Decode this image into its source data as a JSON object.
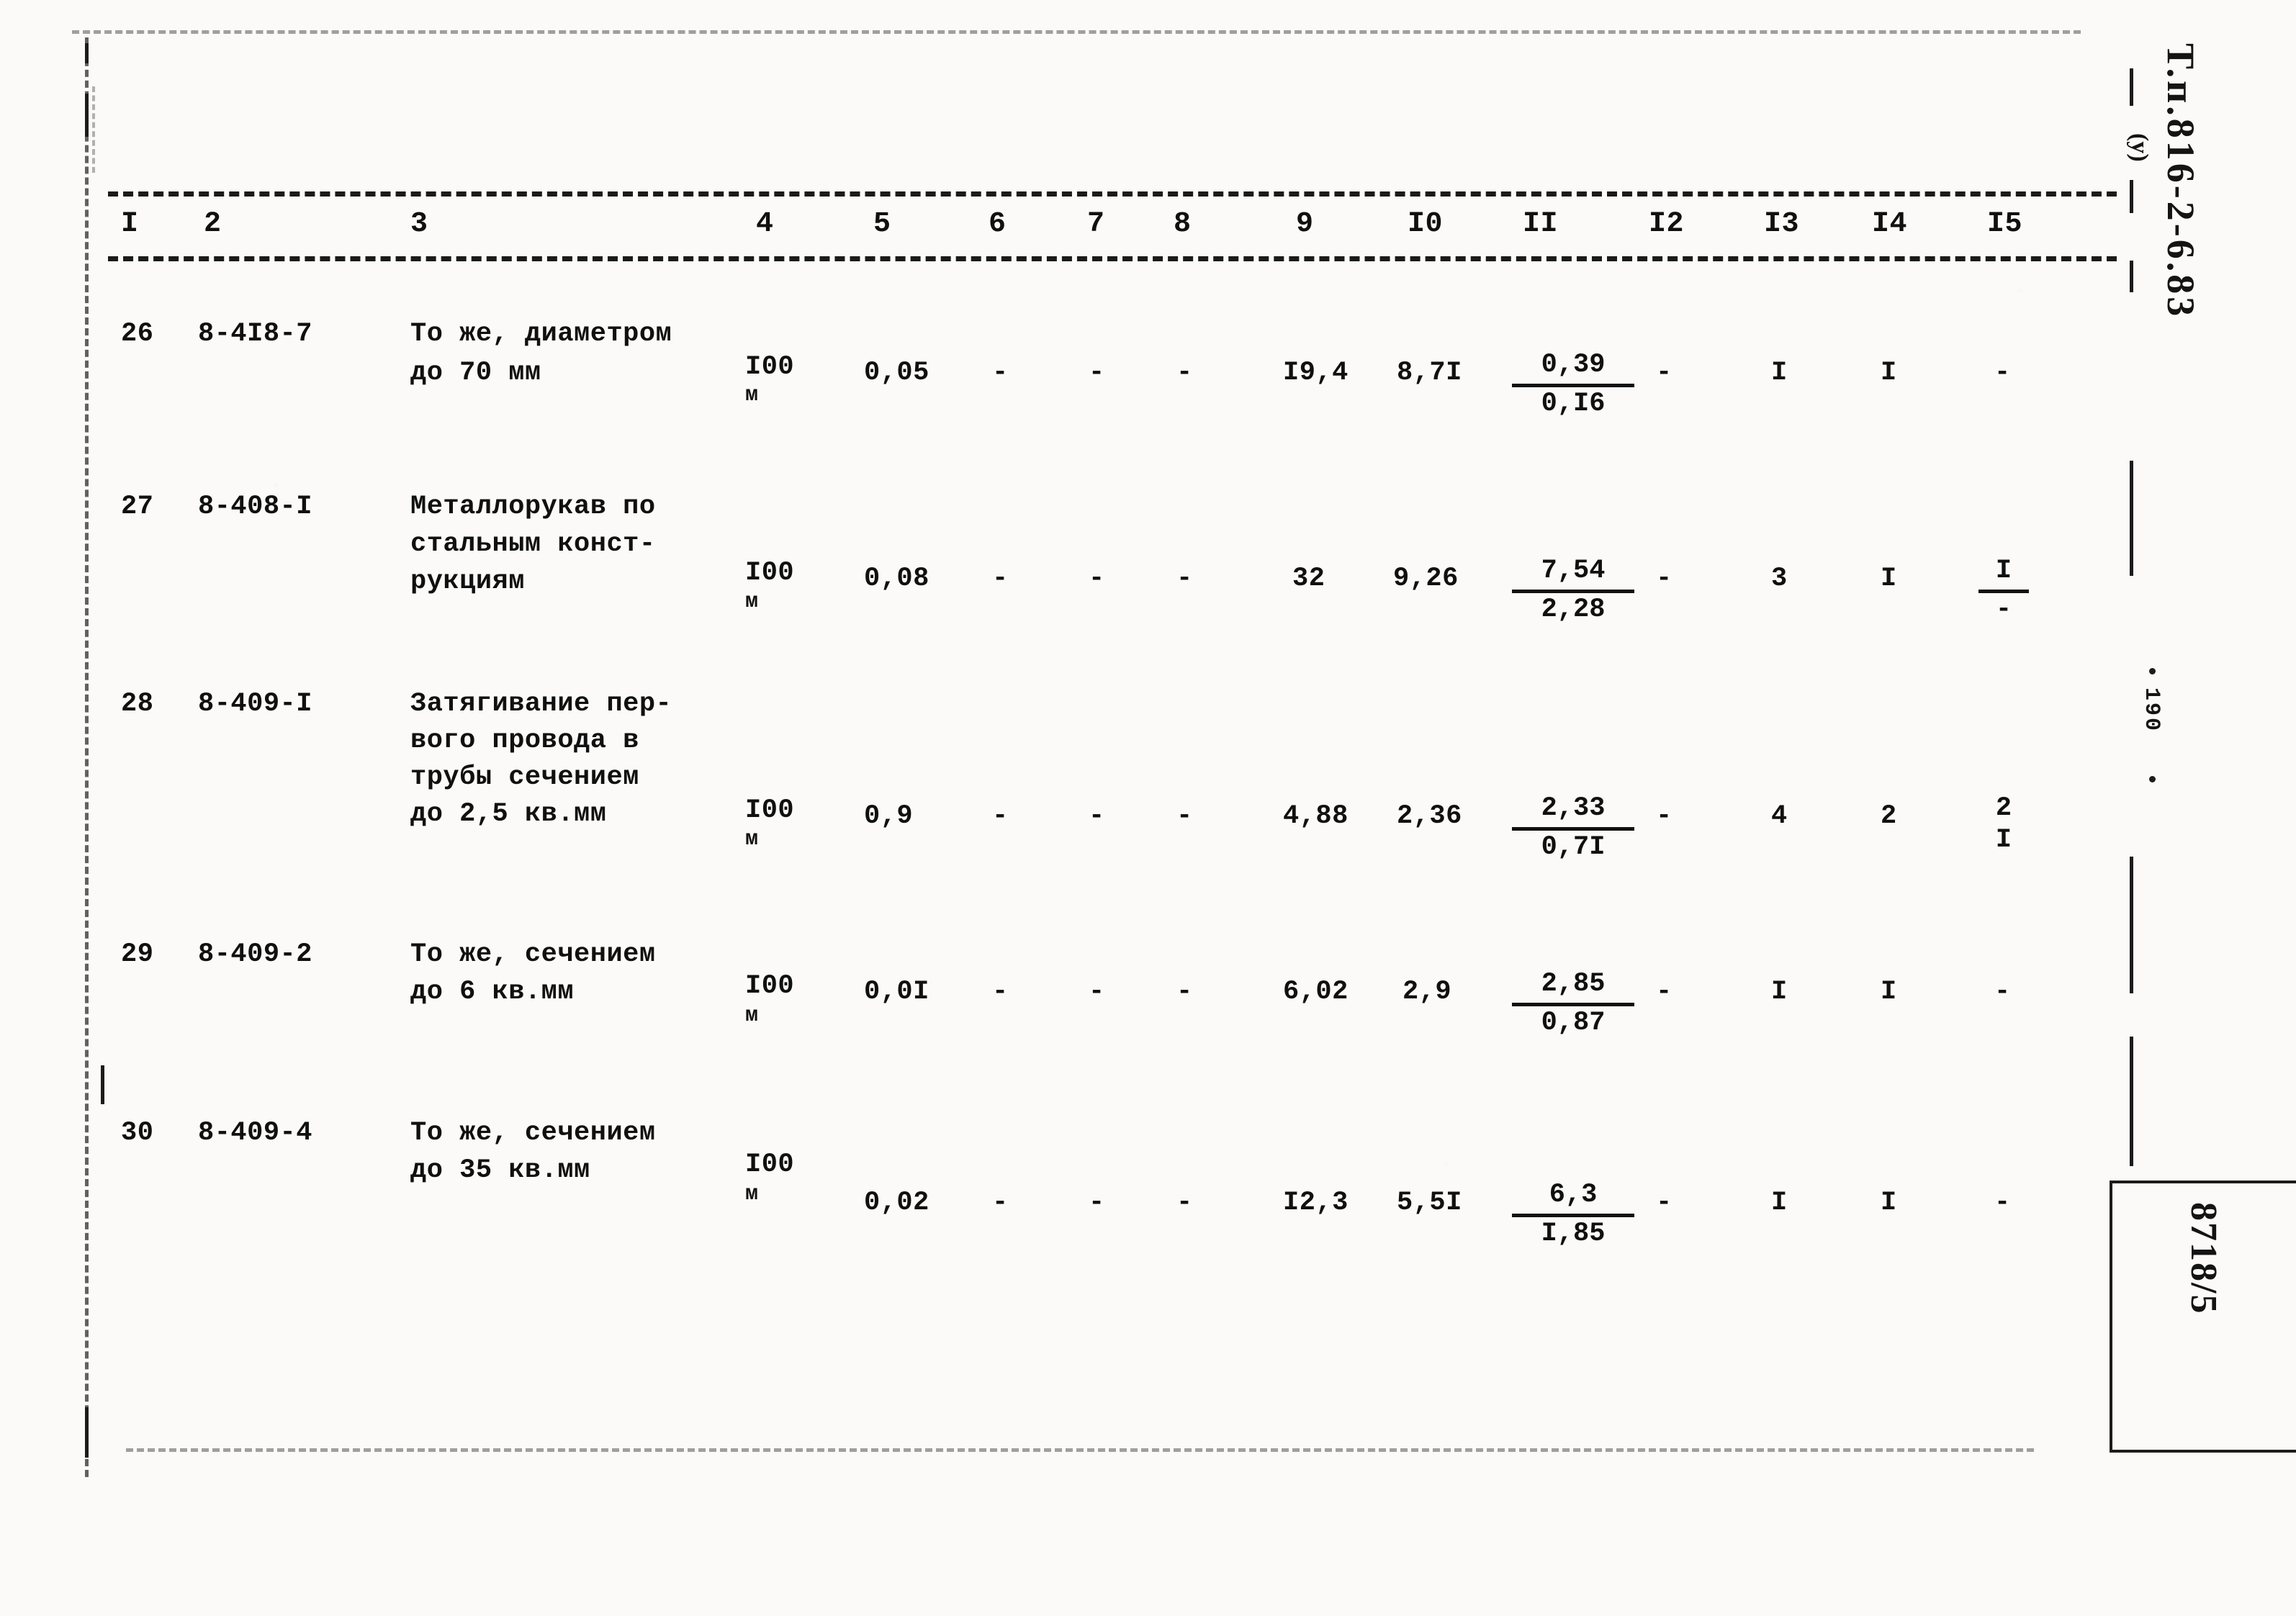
{
  "document": {
    "kind": "scanned-technical-table",
    "margin": {
      "code": "Т.п.816-2-6.83",
      "code_sub": "(у)",
      "page_number": "190",
      "doc_number": "8718/5"
    }
  },
  "table": {
    "column_headers": [
      "I",
      "2",
      "3",
      "4",
      "5",
      "6",
      "7",
      "8",
      "9",
      "I0",
      "II",
      "I2",
      "I3",
      "I4",
      "I5"
    ],
    "rows": [
      {
        "c1": "26",
        "c2": "8-4I8-7",
        "c3_lines": [
          "То же, диаметром",
          "до 70 мм"
        ],
        "c4_lines": [
          "I00",
          "м"
        ],
        "c5": "0,05",
        "c6": "-",
        "c7": "-",
        "c8": "-",
        "c9": "I9,4",
        "c10": "8,7I",
        "c11_top": "0,39",
        "c11_bot": "0,I6",
        "c12": "-",
        "c13": "I",
        "c14": "I",
        "c15_top": "-",
        "c15_bot": ""
      },
      {
        "c1": "27",
        "c2": "8-408-I",
        "c3_lines": [
          "Металлорукав по",
          "стальным конст-",
          "рукциям"
        ],
        "c4_lines": [
          "I00",
          "м"
        ],
        "c5": "0,08",
        "c6": "-",
        "c7": "-",
        "c8": "-",
        "c9": "32",
        "c10": "9,26",
        "c11_top": "7,54",
        "c11_bot": "2,28",
        "c12": "-",
        "c13": "3",
        "c14": "I",
        "c15_top": "I",
        "c15_bot": "-"
      },
      {
        "c1": "28",
        "c2": "8-409-I",
        "c3_lines": [
          "Затягивание пер-",
          "вого провода в",
          "трубы сечением",
          "до 2,5 кв.мм"
        ],
        "c4_lines": [
          "I00",
          "м"
        ],
        "c5": "0,9",
        "c6": "-",
        "c7": "-",
        "c8": "-",
        "c9": "4,88",
        "c10": "2,36",
        "c11_top": "2,33",
        "c11_bot": "0,7I",
        "c12": "-",
        "c13": "4",
        "c14": "2",
        "c15_top": "2",
        "c15_bot": "I"
      },
      {
        "c1": "29",
        "c2": "8-409-2",
        "c3_lines": [
          "То же, сечением",
          "до 6 кв.мм"
        ],
        "c4_lines": [
          "I00",
          "м"
        ],
        "c5": "0,0I",
        "c6": "-",
        "c7": "-",
        "c8": "-",
        "c9": "6,02",
        "c10": "2,9",
        "c11_top": "2,85",
        "c11_bot": "0,87",
        "c12": "-",
        "c13": "I",
        "c14": "I",
        "c15_top": "-",
        "c15_bot": ""
      },
      {
        "c1": "30",
        "c2": "8-409-4",
        "c3_lines": [
          "То же, сечением",
          "до 35 кв.мм"
        ],
        "c4_lines": [
          "I00",
          "м"
        ],
        "c5": "0,02",
        "c6": "-",
        "c7": "-",
        "c8": "-",
        "c9": "I2,3",
        "c10": "5,5I",
        "c11_top": "6,3",
        "c11_bot": "I,85",
        "c12": "-",
        "c13": "I",
        "c14": "I",
        "c15_top": "-",
        "c15_bot": ""
      }
    ]
  }
}
